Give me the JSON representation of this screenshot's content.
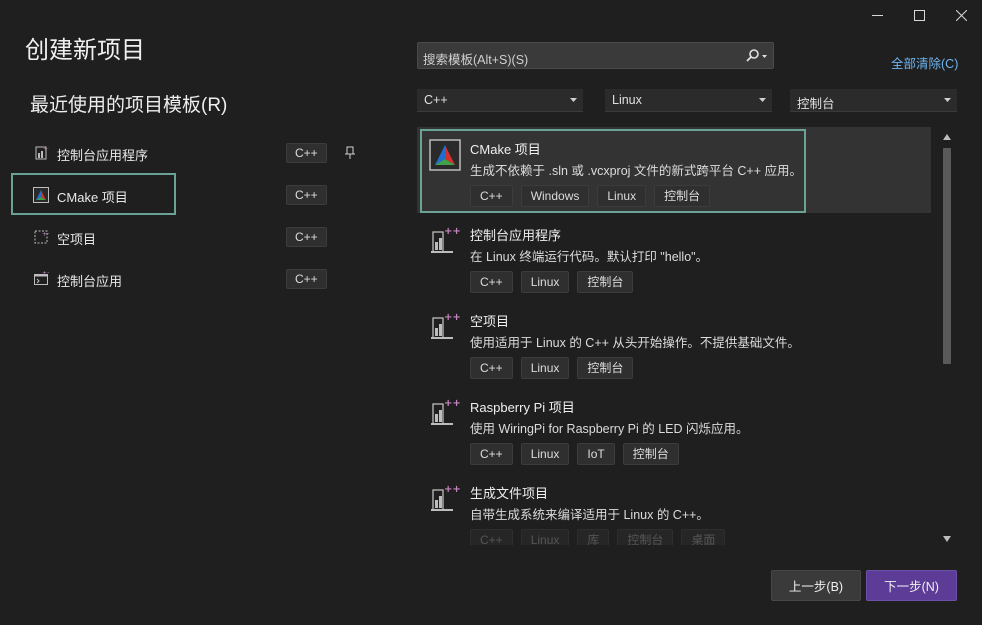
{
  "window": {
    "title": "创建新项目",
    "controls": [
      "minimize-icon",
      "maximize-icon",
      "close-icon"
    ]
  },
  "recent": {
    "heading": "最近使用的项目模板(R)",
    "items": [
      {
        "label": "控制台应用程序",
        "tag": "C++",
        "pinned": true,
        "icon": "console-app-icon"
      },
      {
        "label": "CMake 项目",
        "tag": "C++",
        "selected": true,
        "icon": "cmake-icon"
      },
      {
        "label": "空项目",
        "tag": "C++",
        "icon": "empty-project-icon"
      },
      {
        "label": "控制台应用",
        "tag": "C++",
        "icon": "console-icon"
      }
    ]
  },
  "search": {
    "placeholder": "搜索模板(Alt+S)(S)",
    "clear_all": "全部清除(C)"
  },
  "filters": {
    "language": "C++",
    "platform": "Linux",
    "project_type": "控制台"
  },
  "templates": [
    {
      "name": "CMake 项目",
      "desc": "生成不依赖于 .sln 或 .vcxproj 文件的新式跨平台 C++ 应用。",
      "tags": [
        "C++",
        "Windows",
        "Linux",
        "控制台"
      ],
      "selected": true,
      "icon": "cmake-icon"
    },
    {
      "name": "控制台应用程序",
      "desc": "在 Linux 终端运行代码。默认打印 \"hello\"。",
      "tags": [
        "C++",
        "Linux",
        "控制台"
      ],
      "icon": "linux-project-icon"
    },
    {
      "name": "空项目",
      "desc": "使用适用于 Linux 的 C++ 从头开始操作。不提供基础文件。",
      "tags": [
        "C++",
        "Linux",
        "控制台"
      ],
      "icon": "linux-project-icon"
    },
    {
      "name": "Raspberry Pi 项目",
      "desc": "使用 WiringPi for Raspberry Pi 的 LED 闪烁应用。",
      "tags": [
        "C++",
        "Linux",
        "IoT",
        "控制台"
      ],
      "icon": "linux-project-icon"
    },
    {
      "name": "生成文件项目",
      "desc": "自带生成系统来编译适用于 Linux 的 C++。",
      "tags": [
        "C++",
        "Linux",
        "库",
        "控制台",
        "桌面"
      ],
      "faded_tags": true,
      "icon": "linux-project-icon"
    }
  ],
  "footer": {
    "back": "上一步(B)",
    "next": "下一步(N)"
  },
  "colors": {
    "accent_border": "#6aa396",
    "primary_button": "#5c3c96",
    "link": "#6fb5f0"
  }
}
